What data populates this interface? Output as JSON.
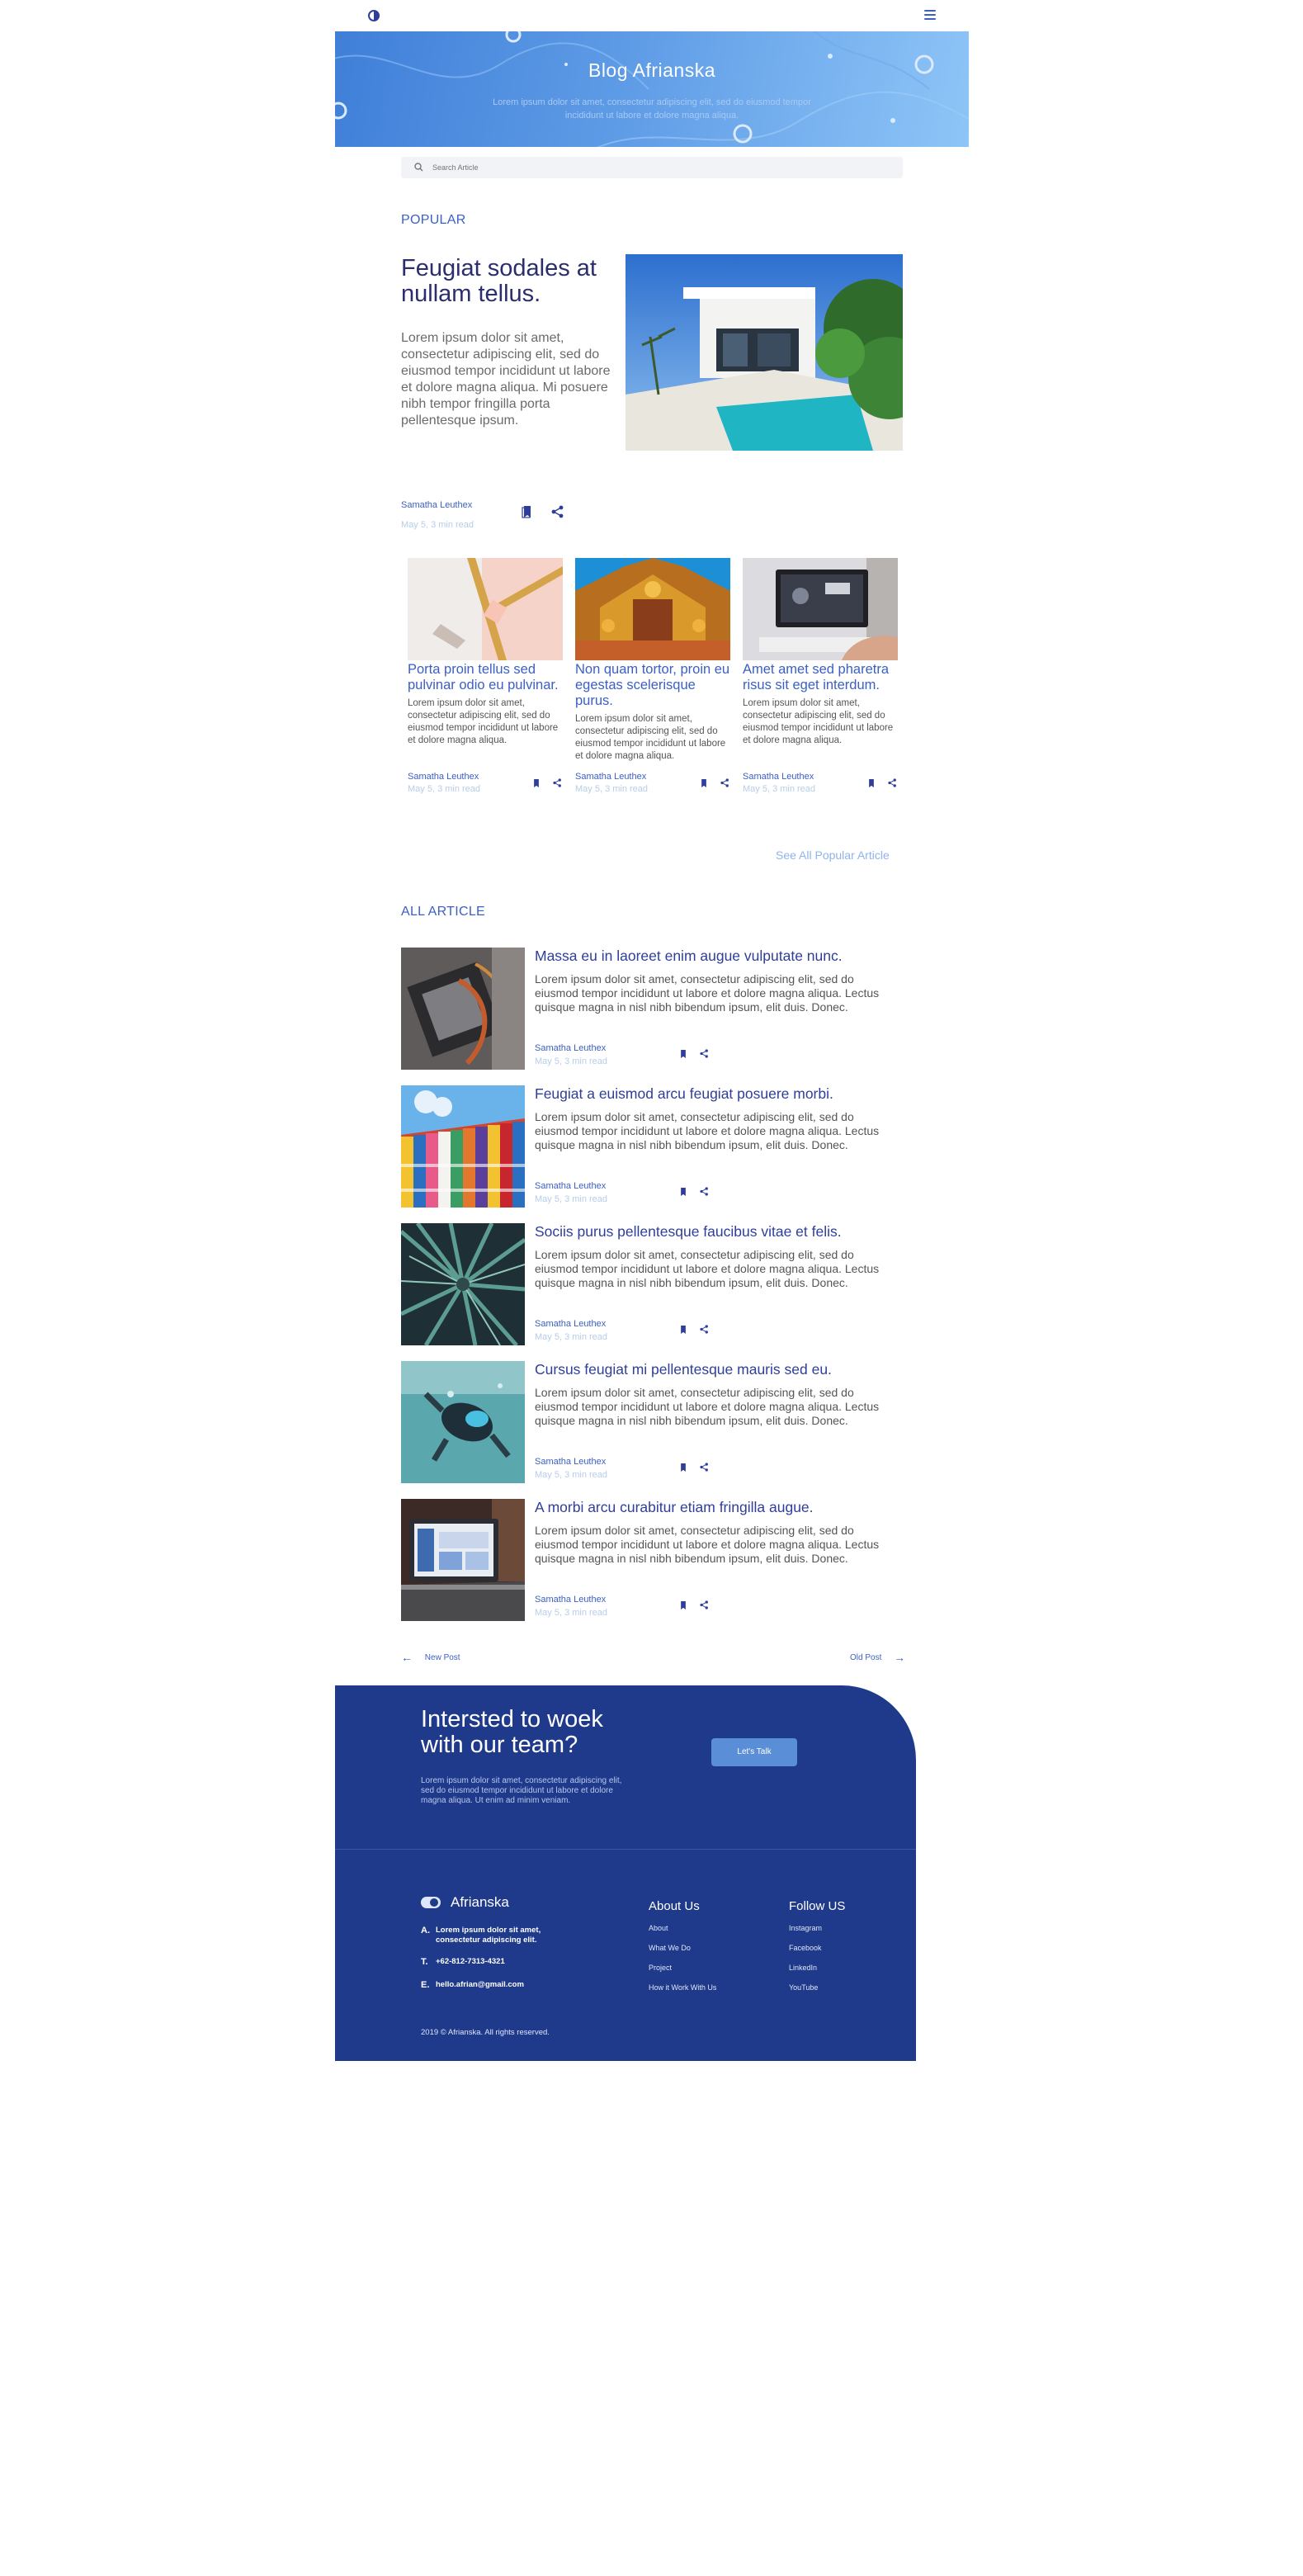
{
  "header": {
    "title": "Blog Afrianska",
    "subtitle": "Lorem ipsum dolor sit amet, consectetur adipiscing elit, sed do eiusmod tempor incididunt ut labore et dolore magna aliqua.",
    "menu_icon": "hamburger-icon",
    "logo_icon": "half-circle-logo"
  },
  "search": {
    "placeholder": "Search Article",
    "icon": "search-icon"
  },
  "popular": {
    "label": "POPULAR",
    "featured": {
      "title": "Feugiat sodales at nullam tellus.",
      "text": "Lorem ipsum dolor sit amet, consectetur adipiscing elit, sed do eiusmod tempor incididunt ut labore et dolore magna aliqua. Mi posuere nibh tempor fringilla porta pellentesque ipsum.",
      "author": "Samatha Leuthex",
      "date": "May 5, 3 min read"
    },
    "cards": [
      {
        "title": "Porta proin tellus sed pulvinar odio eu pulvinar.",
        "text": "Lorem ipsum dolor sit amet, consectetur adipiscing elit, sed do eiusmod tempor incididunt ut labore et dolore magna aliqua.",
        "author": "Samatha Leuthex",
        "date": "May 5, 3 min read"
      },
      {
        "title": "Non quam tortor, proin eu egestas scelerisque purus.",
        "text": "Lorem ipsum dolor sit amet, consectetur adipiscing elit, sed do eiusmod tempor incididunt ut labore et dolore magna aliqua.",
        "author": "Samatha Leuthex",
        "date": "May 5, 3 min read"
      },
      {
        "title": "Amet amet sed pharetra risus sit eget interdum.",
        "text": "Lorem ipsum dolor sit amet, consectetur adipiscing elit, sed do eiusmod tempor incididunt ut labore et dolore magna aliqua.",
        "author": "Samatha Leuthex",
        "date": "May 5, 3 min read"
      }
    ],
    "see_all": "See All Popular Article"
  },
  "all_article": {
    "label": "ALL ARTICLE",
    "items": [
      {
        "title": "Massa eu in laoreet enim augue vulputate nunc.",
        "text": "Lorem ipsum dolor sit amet, consectetur adipiscing elit, sed do eiusmod tempor incididunt ut labore et dolore magna aliqua. Lectus quisque magna in nisl nibh bibendum ipsum, elit duis. Donec.",
        "author": "Samatha Leuthex",
        "date": "May 5, 3 min read"
      },
      {
        "title": "Feugiat a euismod arcu feugiat posuere morbi.",
        "text": "Lorem ipsum dolor sit amet, consectetur adipiscing elit, sed do eiusmod tempor incididunt ut labore et dolore magna aliqua. Lectus quisque magna in nisl nibh bibendum ipsum, elit duis. Donec.",
        "author": "Samatha Leuthex",
        "date": "May 5, 3 min read"
      },
      {
        "title": "Sociis purus pellentesque faucibus vitae et felis.",
        "text": "Lorem ipsum dolor sit amet, consectetur adipiscing elit, sed do eiusmod tempor incididunt ut labore et dolore magna aliqua. Lectus quisque magna in nisl nibh bibendum ipsum, elit duis. Donec.",
        "author": "Samatha Leuthex",
        "date": "May 5, 3 min read"
      },
      {
        "title": "Cursus feugiat mi pellentesque mauris sed eu.",
        "text": "Lorem ipsum dolor sit amet, consectetur adipiscing elit, sed do eiusmod tempor incididunt ut labore et dolore magna aliqua. Lectus quisque magna in nisl nibh bibendum ipsum, elit duis. Donec.",
        "author": "Samatha Leuthex",
        "date": "May 5, 3 min read"
      },
      {
        "title": "A morbi arcu curabitur etiam fringilla augue.",
        "text": "Lorem ipsum dolor sit amet, consectetur adipiscing elit, sed do eiusmod tempor incididunt ut labore et dolore magna aliqua. Lectus quisque magna in nisl nibh bibendum ipsum, elit duis. Donec.",
        "author": "Samatha Leuthex",
        "date": "May 5, 3 min read"
      }
    ],
    "new_post": "New Post",
    "old_post": "Old Post"
  },
  "cta": {
    "title": "Intersted to woek with our team?",
    "text": "Lorem ipsum dolor sit amet, consectetur adipiscing elit, sed do eiusmod tempor incididunt ut labore et dolore magna aliqua. Ut enim ad minim veniam.",
    "button": "Let's Talk"
  },
  "footer": {
    "brand": "Afrianska",
    "address_label": "A.",
    "address": "Lorem ipsum dolor sit amet, consectetur adipiscing elit.",
    "phone_label": "T.",
    "phone": "+62-812-7313-4321",
    "email_label": "E.",
    "email": "hello.afrian@gmail.com",
    "about_title": "About Us",
    "about_links": [
      "About",
      "What We Do",
      "Project",
      "How it Work With Us"
    ],
    "follow_title": "Follow US",
    "follow_links": [
      "Instagram",
      "Facebook",
      "LinkedIn",
      "YouTube"
    ],
    "copyright": "2019 © Afrianska. All rights reserved."
  },
  "colors": {
    "primary": "#3b5fc4",
    "dark_navy": "#1f3a8a",
    "title_navy": "#2b2e6e",
    "muted_blue": "#b7cde9"
  }
}
